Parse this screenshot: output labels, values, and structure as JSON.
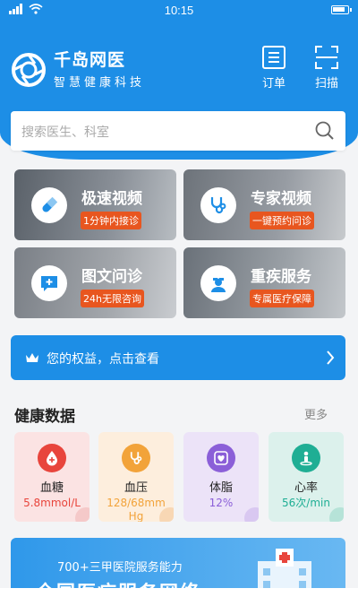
{
  "status_bar": {
    "time": "10:15"
  },
  "brand": {
    "name": "千岛网医",
    "slogan": "智慧健康科技"
  },
  "top_actions": [
    {
      "label": "订单",
      "icon": "order-icon"
    },
    {
      "label": "扫描",
      "icon": "scan-icon"
    }
  ],
  "search": {
    "placeholder": "搜索医生、科室",
    "icon": "search-icon"
  },
  "services": [
    {
      "title": "极速视频",
      "tag": "1分钟内接诊",
      "icon": "pill-icon"
    },
    {
      "title": "专家视频",
      "tag": "一键预约问诊",
      "icon": "stethoscope-icon"
    },
    {
      "title": "图文问诊",
      "tag": "24h无限咨询",
      "icon": "chat-plus-icon"
    },
    {
      "title": "重疾服务",
      "tag": "专属医疗保障",
      "icon": "nurse-icon"
    }
  ],
  "benefit": {
    "label": "您的权益，点击查看",
    "icon": "crown-icon"
  },
  "health": {
    "title": "健康数据",
    "more": "更多",
    "items": [
      {
        "name": "血糖",
        "value": "5.8mmol/L",
        "color": "#e8453c",
        "bg": "#fbe3e3",
        "icon": "blood-drop-icon"
      },
      {
        "name": "血压",
        "value": "128/68mmHg",
        "color": "#f2a33a",
        "bg": "#fdeedd",
        "icon": "stethoscope-icon"
      },
      {
        "name": "体脂",
        "value": "12%",
        "color": "#8b5fd8",
        "bg": "#ece3f8",
        "icon": "heart-scale-icon"
      },
      {
        "name": "心率",
        "value": "56次/min",
        "color": "#1fae94",
        "bg": "#dcf1ec",
        "icon": "person-scale-icon"
      }
    ]
  },
  "banner": {
    "small": "700+三甲医院服务能力",
    "big": "全国医疗服务网络"
  },
  "colors": {
    "primary": "#1d8ee6",
    "tag": "#e8561f",
    "background": "#f3f4f6"
  }
}
